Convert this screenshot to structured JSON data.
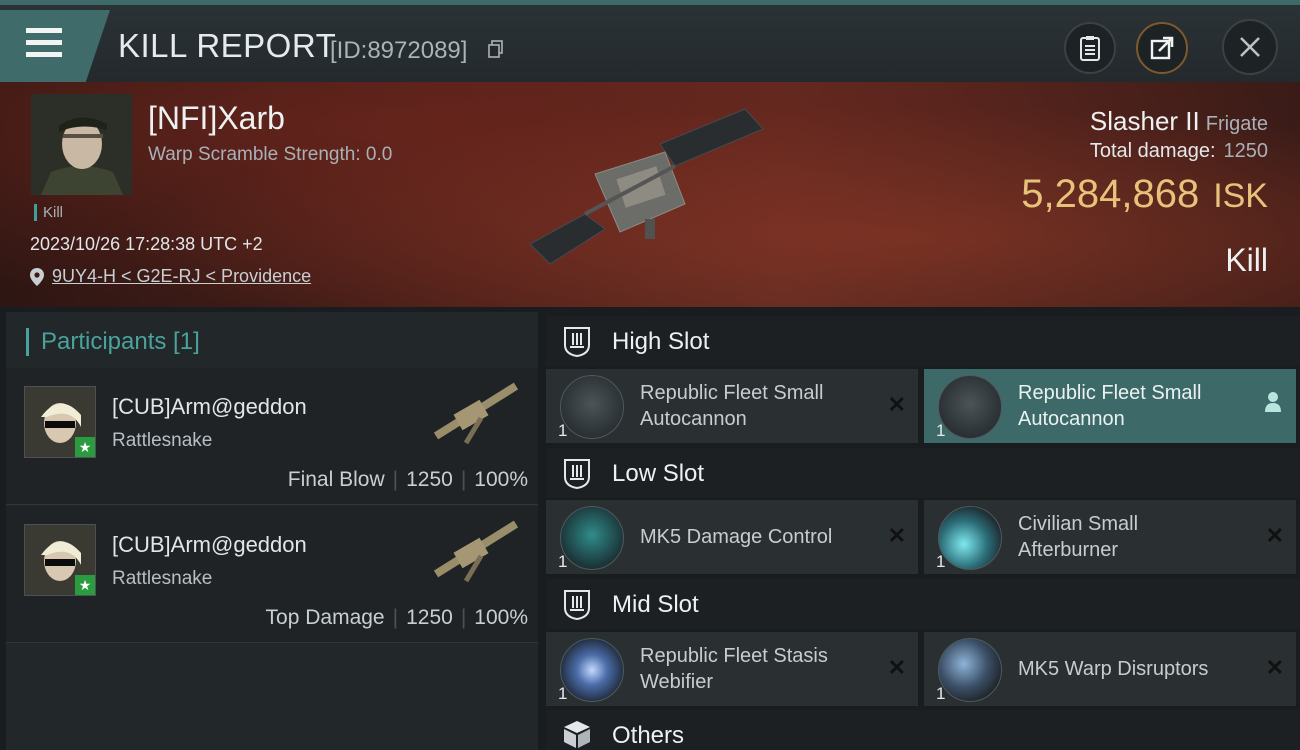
{
  "header": {
    "title": "KILL REPORT",
    "report_id": "[ID:8972089]"
  },
  "victim": {
    "name": "[NFI]Xarb",
    "warp_scramble": "Warp Scramble Strength: 0.0",
    "kill_tag": "Kill",
    "time": "2023/10/26 17:28:38 UTC +2",
    "location": "9UY4-H < G2E-RJ < Providence",
    "ship_name": "Slasher II",
    "ship_class": "Frigate",
    "total_damage_label": "Total damage:",
    "total_damage": "1250",
    "isk_value": "5,284,868",
    "isk_unit": "ISK",
    "kill_type": "Kill"
  },
  "participants": {
    "title": "Participants [1]",
    "rows": [
      {
        "name": "[CUB]Arm@geddon",
        "ship": "Rattlesnake",
        "role": "Final Blow",
        "damage": "1250",
        "percent": "100%"
      },
      {
        "name": "[CUB]Arm@geddon",
        "ship": "Rattlesnake",
        "role": "Top Damage",
        "damage": "1250",
        "percent": "100%"
      }
    ]
  },
  "slots": {
    "high": {
      "title": "High Slot",
      "modules": [
        {
          "qty": "1",
          "line1": "Republic Fleet Small",
          "line2": "Autocannon",
          "state": "destroyed"
        },
        {
          "qty": "1",
          "line1": "Republic Fleet Small",
          "line2": "Autocannon",
          "state": "dropped"
        }
      ]
    },
    "low": {
      "title": "Low Slot",
      "modules": [
        {
          "qty": "1",
          "line1": "MK5 Damage Control",
          "line2": "",
          "state": "destroyed"
        },
        {
          "qty": "1",
          "line1": "Civilian Small",
          "line2": "Afterburner",
          "state": "destroyed"
        }
      ]
    },
    "mid": {
      "title": "Mid Slot",
      "modules": [
        {
          "qty": "1",
          "line1": "Republic Fleet Stasis",
          "line2": "Webifier",
          "state": "destroyed"
        },
        {
          "qty": "1",
          "line1": "MK5 Warp Disruptors",
          "line2": "",
          "state": "destroyed"
        }
      ]
    },
    "others": {
      "title": "Others"
    }
  },
  "colors": {
    "accent": "#3f6c6b",
    "isk": "#e8c27a",
    "participants_accent": "#4aa29c"
  },
  "icons": [
    "menu-icon",
    "copy-icon",
    "clipboard-icon",
    "share-icon",
    "close-icon",
    "pin-icon",
    "slot-icon",
    "cargo-icon",
    "person-icon",
    "remove-icon"
  ]
}
